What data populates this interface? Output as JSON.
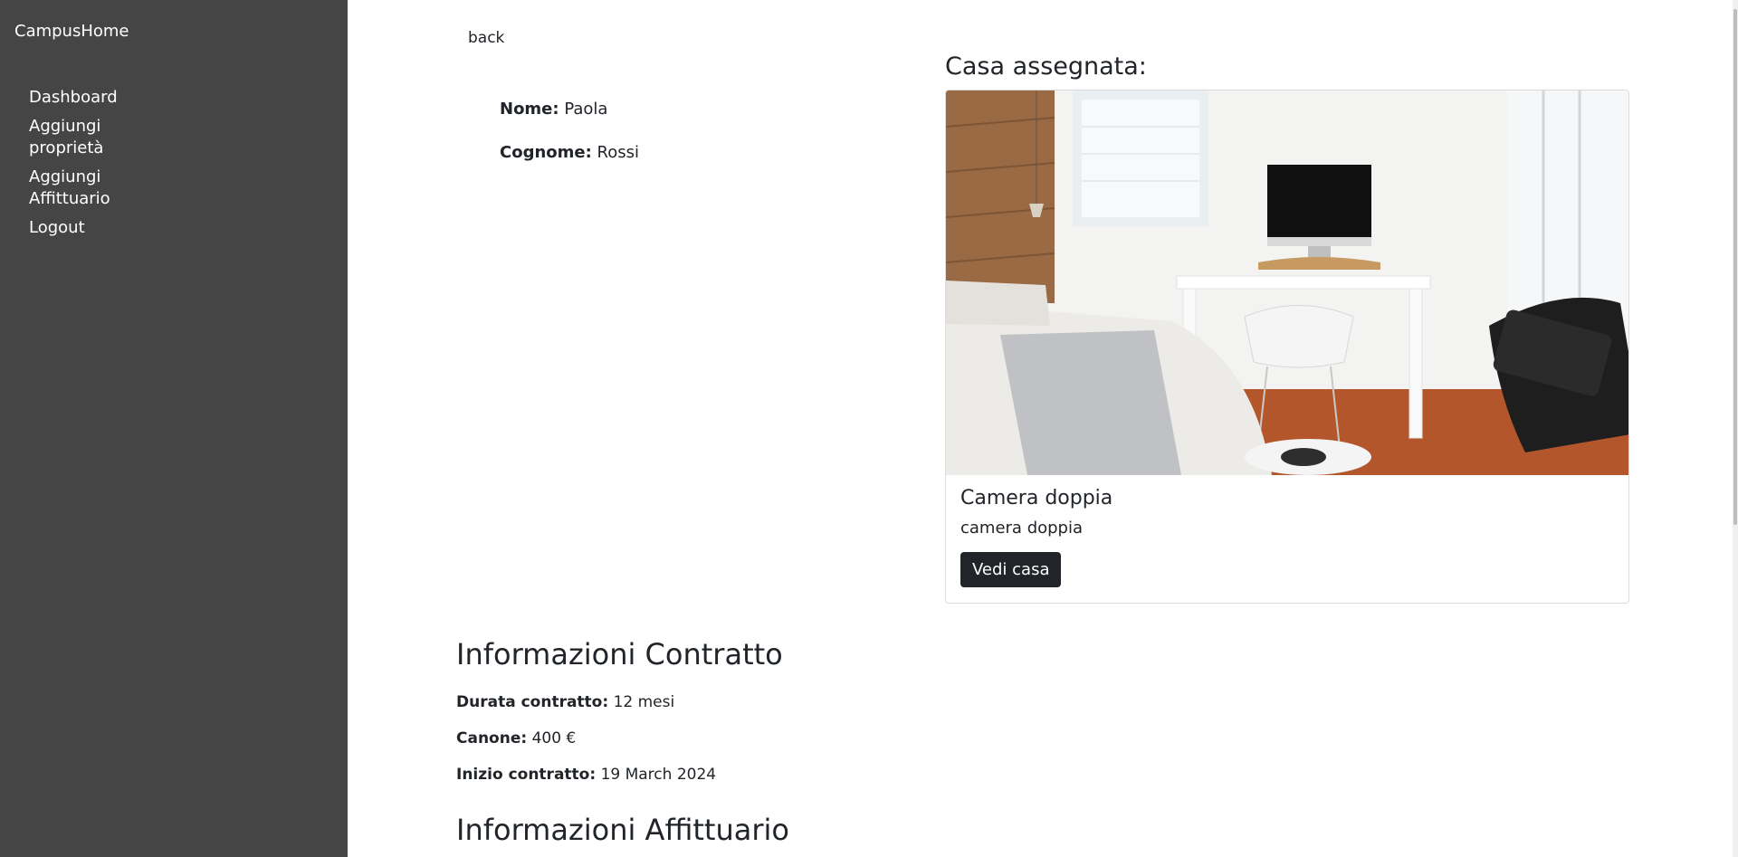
{
  "sidebar": {
    "brand": "CampusHome",
    "items": [
      {
        "label": "Dashboard"
      },
      {
        "label": "Aggiungi proprietà"
      },
      {
        "label": "Aggiungi Affittuario"
      },
      {
        "label": "Logout"
      }
    ]
  },
  "main": {
    "back_label": "back",
    "person": {
      "name_label": "Nome:",
      "name_value": "Paola",
      "surname_label": "Cognome:",
      "surname_value": "Rossi"
    },
    "assigned_title": "Casa assegnata:",
    "house_card": {
      "image_alt": "Camera doppia photo",
      "title": "Camera doppia",
      "description": "camera doppia",
      "button_label": "Vedi casa"
    },
    "contract": {
      "title": "Informazioni Contratto",
      "duration_label": "Durata contratto:",
      "duration_value": "12 mesi",
      "rent_label": "Canone:",
      "rent_value": "400 €",
      "start_label": "Inizio contratto:",
      "start_value": "19 March 2024"
    },
    "tenant_title": "Informazioni Affittuario"
  },
  "colors": {
    "sidebar_bg": "#454545",
    "button_bg": "#212529"
  }
}
